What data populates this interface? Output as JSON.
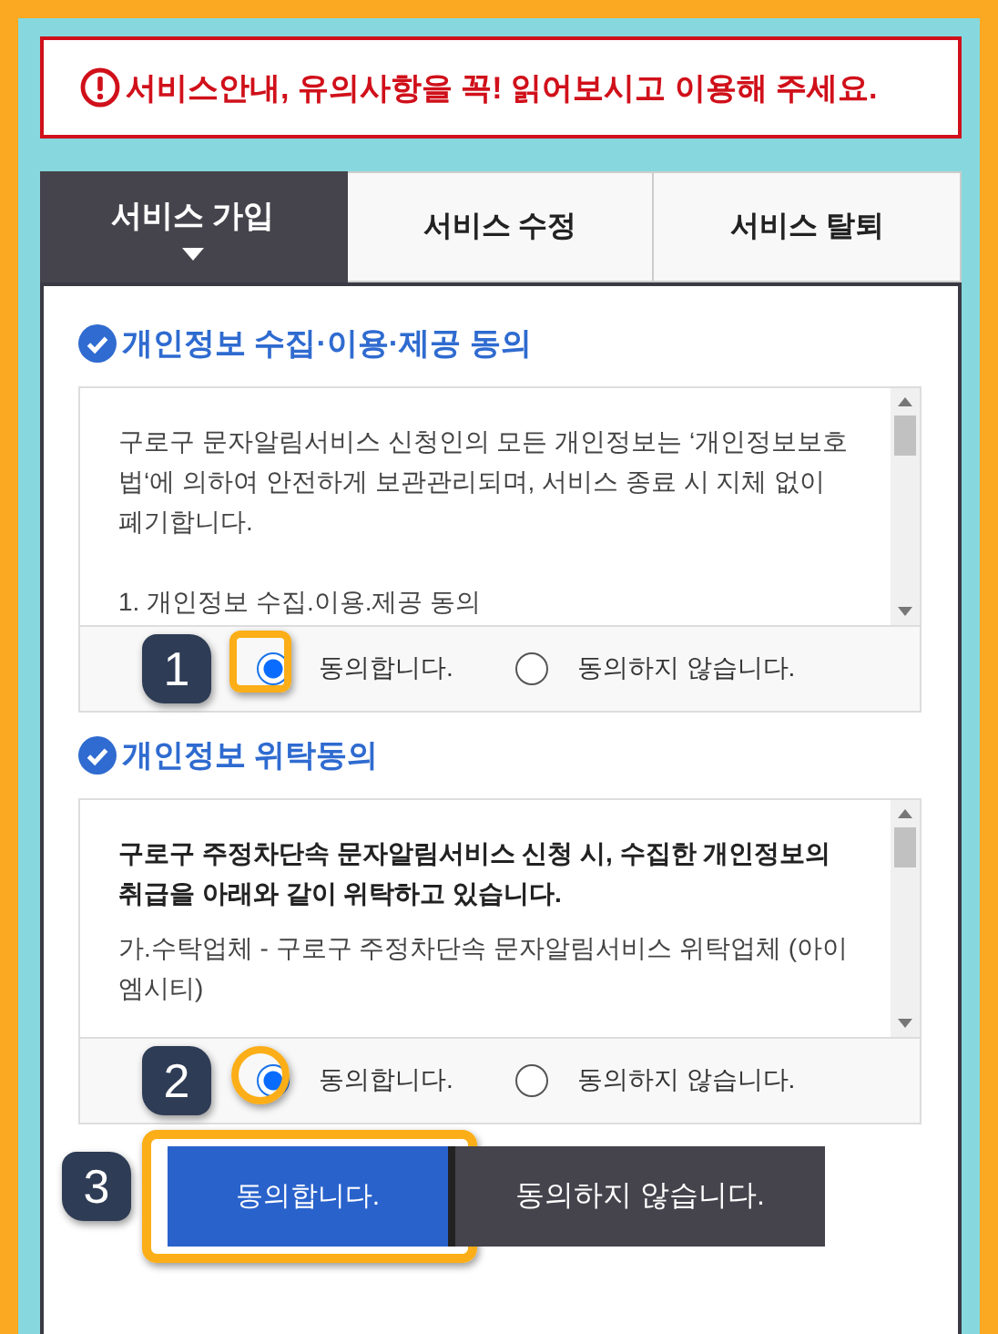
{
  "notice": {
    "text": "서비스안내, 유의사항을 꼭! 읽어보시고 이용해 주세요."
  },
  "tabs": [
    {
      "label": "서비스 가입",
      "selected": true
    },
    {
      "label": "서비스 수정",
      "selected": false
    },
    {
      "label": "서비스 탈퇴",
      "selected": false
    }
  ],
  "sections": [
    {
      "title": "개인정보 수집·이용·제공 동의",
      "paragraphs": [
        {
          "text": "구로구 문자알림서비스 신청인의 모든 개인정보는 ‘개인정보보호법‘에 의하여 안전하게 보관관리되며, 서비스 종료 시 지체 없이 폐기합니다.",
          "bold": false
        },
        {
          "text": "1. 개인정보 수집.이용.제공 동의",
          "bold": false
        }
      ],
      "options": [
        {
          "label": "동의합니다.",
          "selected": true
        },
        {
          "label": "동의하지 않습니다.",
          "selected": false
        }
      ],
      "callout": "1"
    },
    {
      "title": "개인정보 위탁동의",
      "paragraphs": [
        {
          "text": "구로구 주정차단속 문자알림서비스 신청 시, 수집한 개인정보의 취급을 아래와 같이 위탁하고 있습니다.",
          "bold": true
        },
        {
          "text": "가.수탁업체 - 구로구 주정차단속 문자알림서비스 위탁업체 (아이엠시티)",
          "bold": false
        }
      ],
      "options": [
        {
          "label": "동의합니다.",
          "selected": true
        },
        {
          "label": "동의하지 않습니다.",
          "selected": false
        }
      ],
      "callout": "2"
    }
  ],
  "buttons": [
    {
      "label": "동의합니다.",
      "kind": "primary",
      "callout": "3"
    },
    {
      "label": "동의하지 않습니다.",
      "kind": "secondary"
    }
  ]
}
